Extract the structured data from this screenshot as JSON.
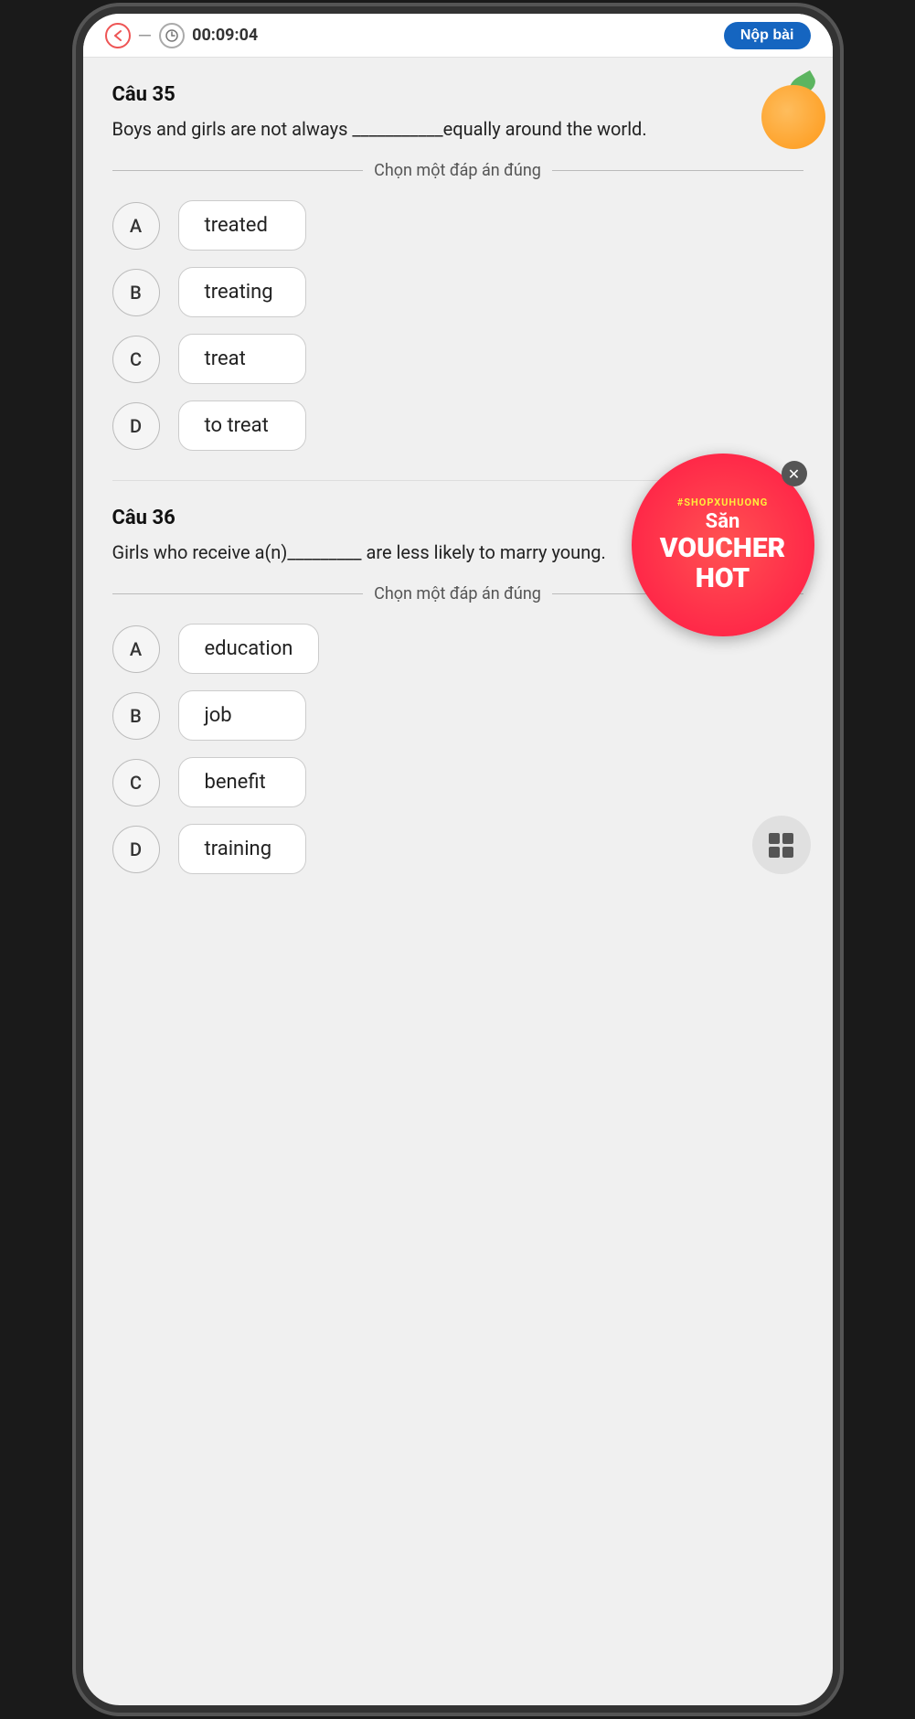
{
  "statusBar": {
    "time": "00:09:04",
    "nopBaiLabel": "Nộp bài"
  },
  "question35": {
    "title": "Câu 35",
    "text": "Boys and girls are not always ___________equally around the world.",
    "chooseLabel": "Chọn một đáp án đúng",
    "options": [
      {
        "letter": "A",
        "text": "treated"
      },
      {
        "letter": "B",
        "text": "treating"
      },
      {
        "letter": "C",
        "text": "treat"
      },
      {
        "letter": "D",
        "text": "to treat"
      }
    ]
  },
  "question36": {
    "title": "Câu 36",
    "text": "Girls who receive a(n)_________ are less likely to marry young.",
    "chooseLabel": "Chọn một đáp án đúng",
    "options": [
      {
        "letter": "A",
        "text": "education"
      },
      {
        "letter": "B",
        "text": "job"
      },
      {
        "letter": "C",
        "text": "benefit"
      },
      {
        "letter": "D",
        "text": "training"
      }
    ]
  },
  "voucher": {
    "tag": "#SHOPXUHUONG",
    "san": "Săn",
    "line1": "VOUCHER",
    "line2": "HOT"
  }
}
